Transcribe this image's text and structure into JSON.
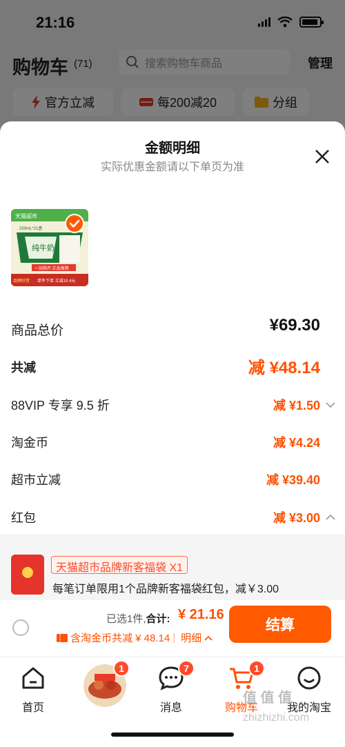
{
  "status_bar": {
    "time": "21:16"
  },
  "header": {
    "title": "购物车",
    "count": "(71)",
    "search_placeholder": "搜索购物车商品",
    "manage": "管理"
  },
  "filters": [
    {
      "label": "官方立减",
      "icon": "lightning-icon"
    },
    {
      "label": "每200减20",
      "icon": "coupon-icon"
    },
    {
      "label": "分组",
      "icon": "folder-icon"
    }
  ],
  "sheet": {
    "title": "金额明细",
    "subtitle": "实际优惠金额请以下单页为准",
    "product_image_text": {
      "brand_tag": "天猫超市",
      "spec": "250mL*21盒",
      "name": "纯牛奶",
      "bottom": "单件下单 立减19.4元",
      "promise": "一站购齐 正品保障",
      "badge": "品牌好货"
    },
    "rows": [
      {
        "label": "商品总价",
        "value": "¥69.30"
      },
      {
        "label": "共减",
        "value": "减 ¥48.14"
      },
      {
        "label": "88VIP 专享 9.5 折",
        "value": "减 ¥1.50"
      },
      {
        "label": "淘金币",
        "value": "减 ¥4.24"
      },
      {
        "label": "超市立减",
        "value": "减 ¥39.40"
      },
      {
        "label": "红包",
        "value": "减 ¥3.00"
      }
    ],
    "hongbao": {
      "tag": "天猫超市品牌新客福袋 X1",
      "desc": "每笔订单限用1个品牌新客福袋红包，减￥3.00"
    }
  },
  "checkout": {
    "selected": "已选1件,",
    "total_label": "合计:",
    "total_value": "¥ 21.16",
    "coin_text": "含淘金币共减 ¥ 48.14",
    "detail": "明细",
    "button": "结算"
  },
  "tabbar": {
    "home": "首页",
    "promo_badge": "1",
    "messages": "消息",
    "messages_badge": "7",
    "cart": "购物车",
    "cart_badge": "1",
    "me": "我的淘宝"
  },
  "watermark": {
    "text": "值 值 值",
    "url": "zhizhizhi.com"
  },
  "colors": {
    "accent": "#ff5000",
    "button": "#ff5a00"
  }
}
